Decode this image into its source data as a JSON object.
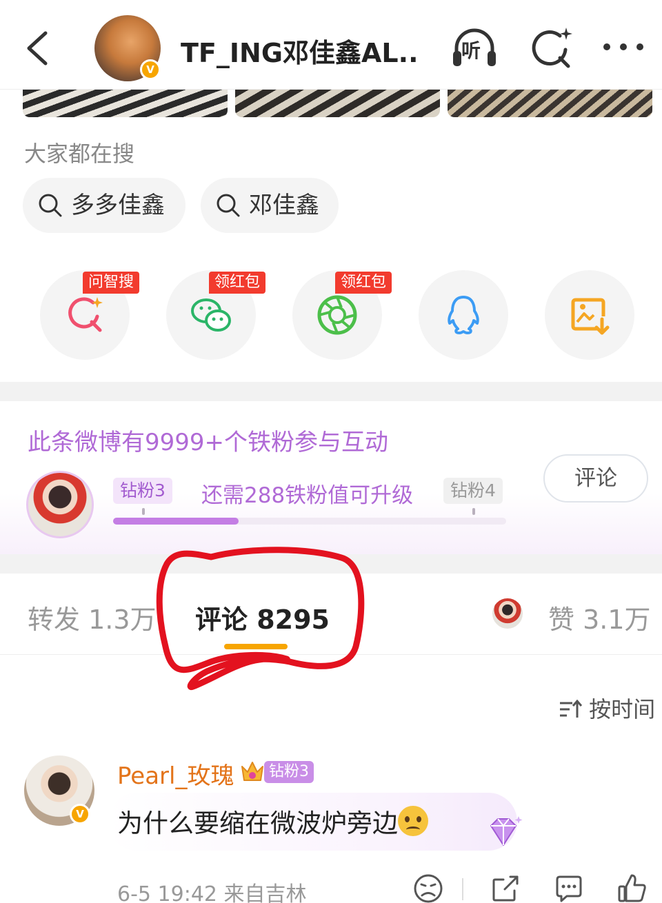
{
  "header": {
    "title": "TF_ING邓佳鑫AL...",
    "listen_label": "听",
    "icons": [
      "back-arrow-icon",
      "listen-headphones-icon",
      "ai-search-icon",
      "more-dots-icon"
    ],
    "verified_badge": "V"
  },
  "search": {
    "label": "大家都在搜",
    "suggestions": [
      "多多佳鑫",
      "邓佳鑫"
    ]
  },
  "share": {
    "tags": [
      "问智搜",
      "领红包",
      "领红包"
    ],
    "icons": [
      "ai-search-icon",
      "wechat-icon",
      "moments-icon",
      "qq-icon",
      "save-image-icon"
    ]
  },
  "fans": {
    "title": "此条微博有9999+个铁粉参与互动",
    "current_level": "钻粉3",
    "next_level": "钻粉4",
    "progress_text": "还需288铁粉值可升级",
    "progress_fraction": 0.32,
    "comment_button": "评论"
  },
  "tabs": {
    "repost": "转发 1.3万",
    "comment": "评论 8295",
    "like": "赞 3.1万"
  },
  "sort": {
    "label": "按时间"
  },
  "comment": {
    "username": "Pearl_玫瑰",
    "badge": "钻粉3",
    "text": "为什么要缩在微波炉旁边",
    "meta": "6-5 19:42  来自吉林",
    "verified_badge": "V"
  },
  "colors": {
    "accent_orange": "#f7a500",
    "tag_red": "#f23b2e",
    "fan_purple": "#b06ad6",
    "annotation_red": "#e3121f"
  }
}
